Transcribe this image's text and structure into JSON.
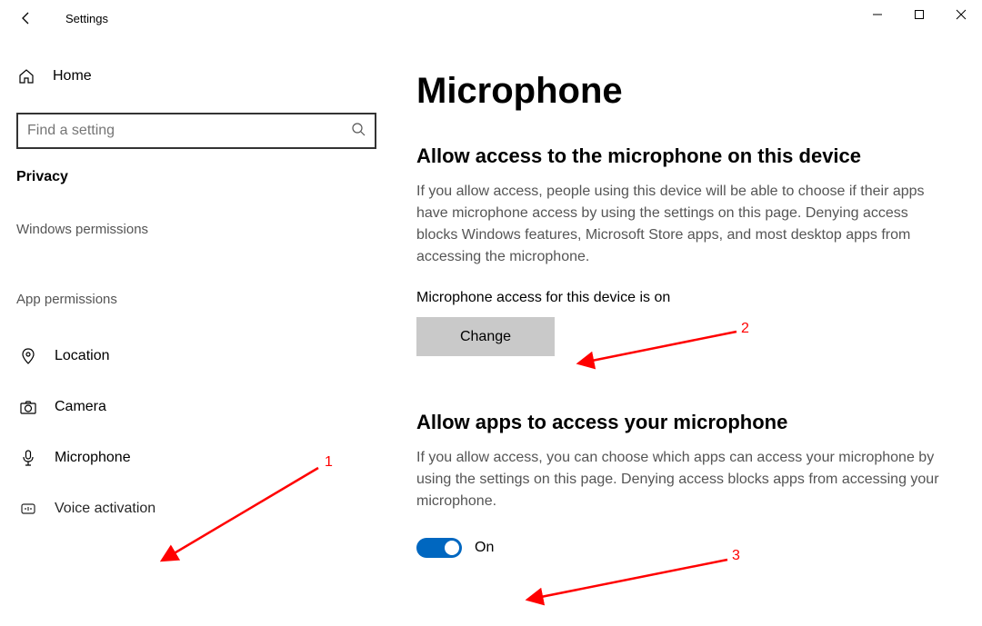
{
  "titlebar": {
    "app_title": "Settings"
  },
  "sidebar": {
    "home_label": "Home",
    "search_placeholder": "Find a setting",
    "category_label": "Privacy",
    "subhead_windows": "Windows permissions",
    "subhead_app": "App permissions",
    "nav": {
      "location": "Location",
      "camera": "Camera",
      "microphone": "Microphone",
      "voice_activation": "Voice activation"
    }
  },
  "main": {
    "page_title": "Microphone",
    "section1": {
      "title": "Allow access to the microphone on this device",
      "desc": "If you allow access, people using this device will be able to choose if their apps have microphone access by using the settings on this page. Denying access blocks Windows features, Microsoft Store apps, and most desktop apps from accessing the microphone.",
      "status": "Microphone access for this device is on",
      "change_label": "Change"
    },
    "section2": {
      "title": "Allow apps to access your microphone",
      "desc": "If you allow access, you can choose which apps can access your microphone by using the settings on this page. Denying access blocks apps from accessing your microphone.",
      "toggle_label": "On"
    }
  },
  "annotations": {
    "a1": "1",
    "a2": "2",
    "a3": "3"
  }
}
